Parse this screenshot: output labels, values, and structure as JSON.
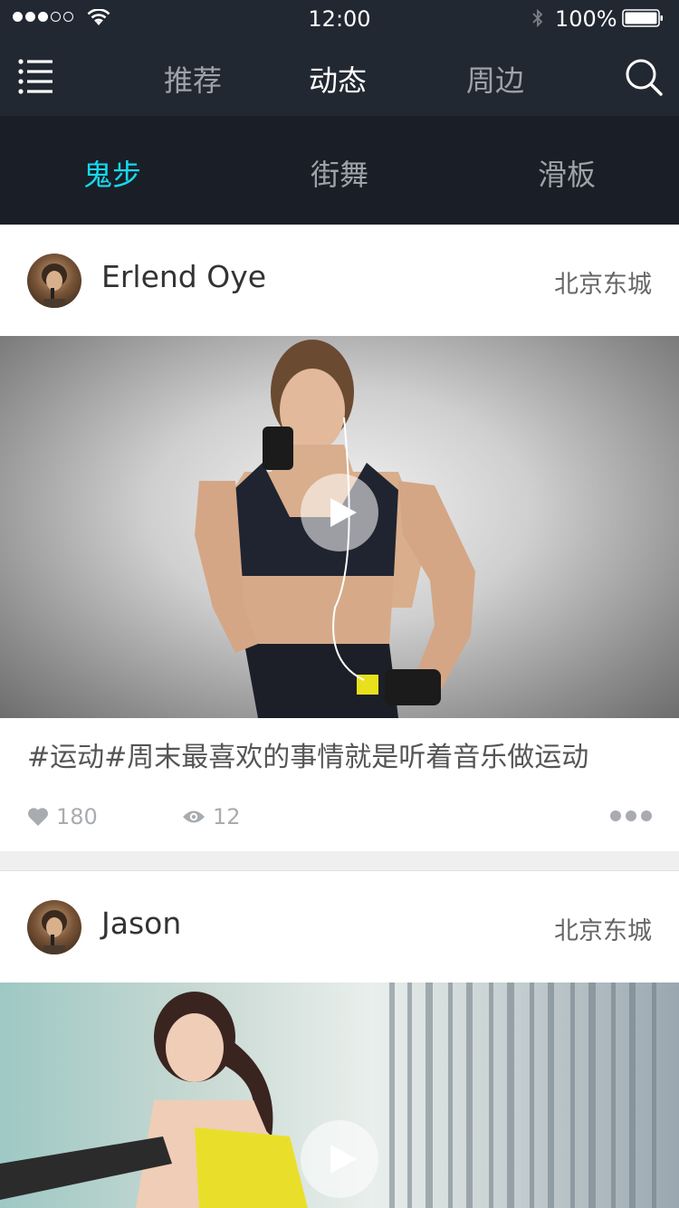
{
  "status_bar": {
    "time": "12:00",
    "battery_percent": "100%",
    "signal_bars_on": 3,
    "signal_bars_total": 5
  },
  "nav": {
    "tabs": [
      {
        "label": "推荐",
        "active": false
      },
      {
        "label": "动态",
        "active": true
      },
      {
        "label": "周边",
        "active": false
      }
    ]
  },
  "sub_tabs": [
    {
      "label": "鬼步",
      "active": true
    },
    {
      "label": "街舞",
      "active": false
    },
    {
      "label": "滑板",
      "active": false
    }
  ],
  "posts": [
    {
      "author": "Erlend Oye",
      "location": "北京东城",
      "caption": "#运动#周末最喜欢的事情就是听着音乐做运动",
      "likes": "180",
      "views": "12"
    },
    {
      "author": "Jason",
      "location": "北京东城"
    }
  ],
  "colors": {
    "header_bg": "#222832",
    "subtab_bg": "#1a1f27",
    "accent": "#16d9f0",
    "muted": "#9ea3a9"
  },
  "icons": [
    "menu-icon",
    "search-icon",
    "wifi-icon",
    "bluetooth-icon",
    "battery-icon",
    "heart-icon",
    "eye-icon",
    "more-icon",
    "play-icon"
  ]
}
